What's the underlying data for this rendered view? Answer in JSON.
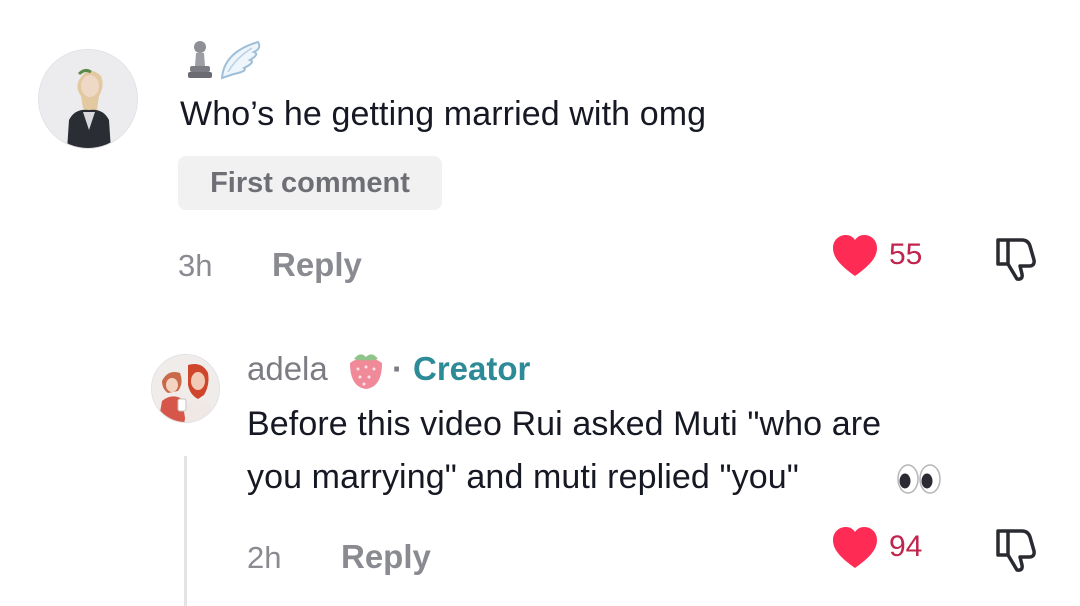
{
  "comment": {
    "text": "Who’s he getting married with omg",
    "badge": "First comment",
    "time": "3h",
    "reply_label": "Reply",
    "likes": "55"
  },
  "reply": {
    "username": "adela",
    "separator": "·",
    "creator_label": "Creator",
    "text_line1": "Before this video Rui asked Muti \"who are",
    "text_line2": "you marrying\" and muti replied \"you\"",
    "time": "2h",
    "reply_label": "Reply",
    "likes": "94"
  },
  "colors": {
    "heart": "#fe2c55",
    "creator": "#2d8a97",
    "text": "#161823",
    "muted": "#8a8b91"
  },
  "icons": {
    "username_decor": [
      "chess-pawn-icon",
      "wing-icon"
    ],
    "username_suffix": "strawberry-icon",
    "emoji_suffix": "eyes-icon",
    "like": "heart-icon",
    "dislike": "thumbs-down-icon"
  }
}
